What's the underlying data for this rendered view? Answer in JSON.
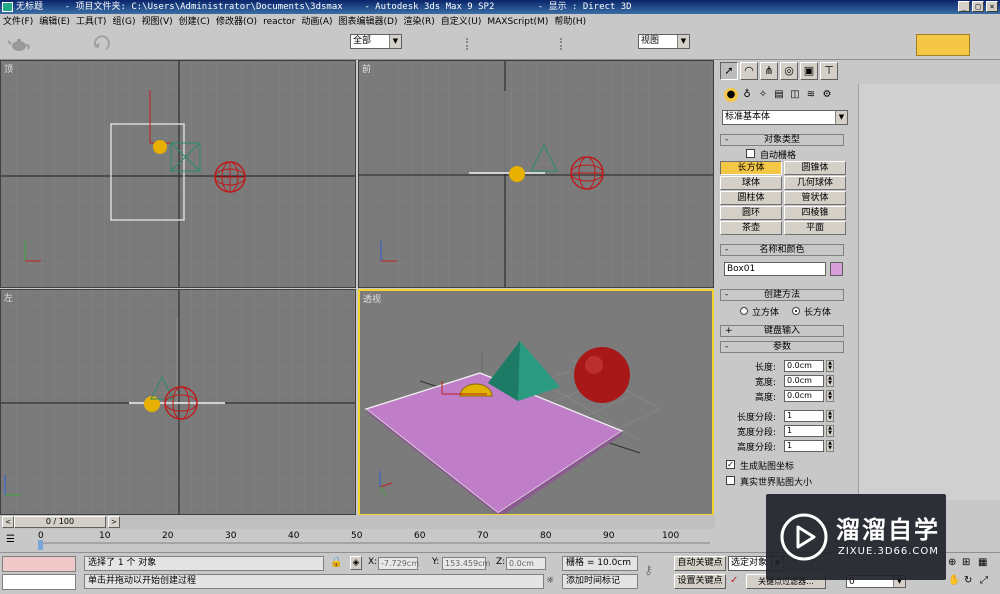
{
  "titlebar": {
    "text": "无标题    - 项目文件夹: C:\\Users\\Administrator\\Documents\\3dsmax    - Autodesk 3ds Max 9 SP2        - 显示 : Direct 3D",
    "min": "_",
    "max": "□",
    "close": "×"
  },
  "menu": [
    "文件(F)",
    "编辑(E)",
    "工具(T)",
    "组(G)",
    "视图(V)",
    "创建(C)",
    "修改器(O)",
    "reactor",
    "动画(A)",
    "图表编辑器(D)",
    "渲染(R)",
    "自定义(U)",
    "MAXScript(M)",
    "帮助(H)"
  ],
  "toolbar": {
    "selection_filter": "全部",
    "coord_system": "视图",
    "accent": "#f4c846"
  },
  "viewports": {
    "top": "顶",
    "front": "前",
    "left": "左",
    "perspective": "透视"
  },
  "panel": {
    "primitive_type": "标准基本体",
    "object_type": {
      "title": "对象类型",
      "autogrid": "自动栅格",
      "buttons": [
        "长方体",
        "圆锥体",
        "球体",
        "几何球体",
        "圆柱体",
        "管状体",
        "圆环",
        "四棱锥",
        "茶壶",
        "平面"
      ],
      "active": "长方体"
    },
    "name_color": {
      "title": "名称和颜色",
      "name": "Box01",
      "swatch": "#d8a0d8"
    },
    "creation_method": {
      "title": "创建方法",
      "cube": "立方体",
      "box": "长方体"
    },
    "keyboard_entry": "键盘输入",
    "params": {
      "title": "参数",
      "length": "长度:",
      "width": "宽度:",
      "height": "高度:",
      "length_val": "0.0cm",
      "width_val": "0.0cm",
      "height_val": "0.0cm",
      "lseg": "长度分段:",
      "wseg": "宽度分段:",
      "hseg": "高度分段:",
      "lseg_val": "1",
      "wseg_val": "1",
      "hseg_val": "1",
      "gen_map": "生成贴图坐标",
      "real_world": "真实世界贴图大小"
    }
  },
  "timeline": {
    "frame": "0 / 100",
    "ticks": [
      "0",
      "10",
      "20",
      "30",
      "40",
      "50",
      "60",
      "70",
      "80",
      "90",
      "100"
    ]
  },
  "status": {
    "selected": "选择了 1 个 对象",
    "prompt": "单击并拖动以开始创建过程",
    "x_label": "X:",
    "x_val": "-7.729cm",
    "y_label": "Y:",
    "y_val": "153.459cm",
    "z_label": "Z:",
    "z_val": "0.0cm",
    "grid": "栅格 = 10.0cm",
    "add_tag": "添加时间标记",
    "autokey": "自动关键点",
    "setkey": "设置关键点",
    "selected_obj": "选定对象",
    "key_filter": "关键点过滤器...",
    "frame_val": "0"
  },
  "watermark": {
    "brand": "溜溜自学",
    "url": "ZIXUE.3D66.COM"
  }
}
